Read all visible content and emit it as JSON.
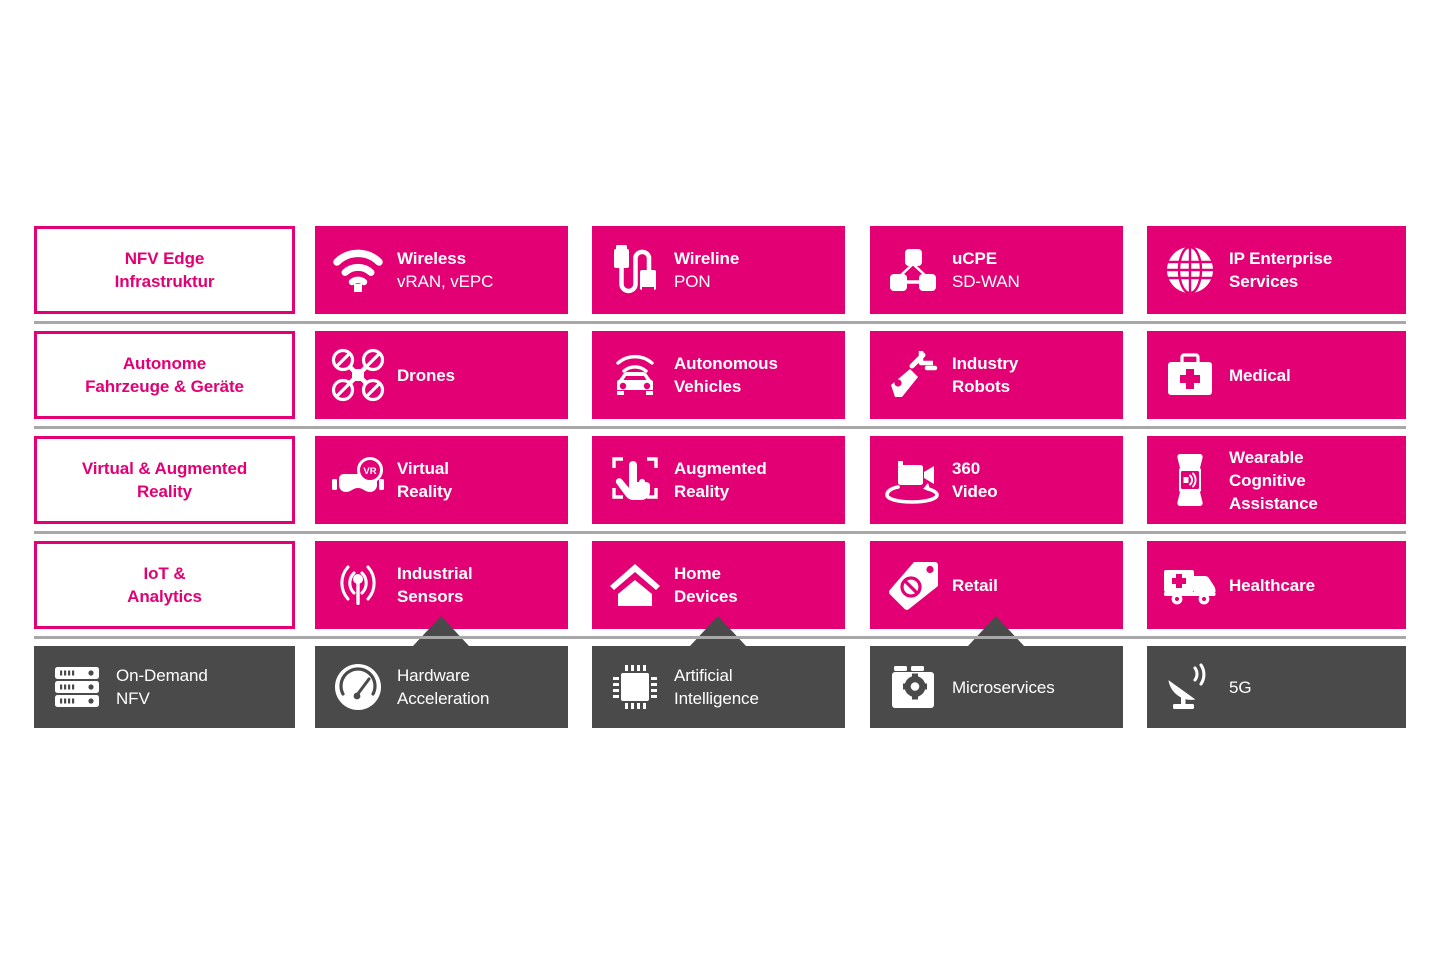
{
  "colors": {
    "magenta": "#e20074",
    "dark_gray": "#4a4a4a",
    "rule_gray": "#a8a8a8",
    "white": "#ffffff"
  },
  "rows": [
    {
      "category": "NFV Edge\nInfrastruktur",
      "cards": [
        {
          "icon": "wifi-icon",
          "line1": "Wireless",
          "line2": "vRAN, vEPC",
          "line2_bold": false
        },
        {
          "icon": "cable-icon",
          "line1": "Wireline",
          "line2": "PON",
          "line2_bold": false
        },
        {
          "icon": "network-node-icon",
          "line1": "uCPE",
          "line2": "SD-WAN",
          "line2_bold": false
        },
        {
          "icon": "globe-icon",
          "line1": "IP Enterprise",
          "line2": "Services",
          "line2_bold": true
        }
      ]
    },
    {
      "category": "Autonome\nFahrzeuge & Geräte",
      "cards": [
        {
          "icon": "drone-icon",
          "line1": "Drones",
          "line2": "",
          "line2_bold": false
        },
        {
          "icon": "autonomous-car-icon",
          "line1": "Autonomous",
          "line2": "Vehicles",
          "line2_bold": true
        },
        {
          "icon": "robot-arm-icon",
          "line1": "Industry",
          "line2": "Robots",
          "line2_bold": true
        },
        {
          "icon": "first-aid-kit-icon",
          "line1": "Medical",
          "line2": "",
          "line2_bold": false
        }
      ]
    },
    {
      "category": "Virtual & Augmented\nReality",
      "cards": [
        {
          "icon": "vr-headset-icon",
          "line1": "Virtual",
          "line2": "Reality",
          "line2_bold": true
        },
        {
          "icon": "ar-hand-icon",
          "line1": "Augmented",
          "line2": "Reality",
          "line2_bold": true
        },
        {
          "icon": "video-360-icon",
          "line1": "360",
          "line2": "Video",
          "line2_bold": true
        },
        {
          "icon": "smartwatch-icon",
          "line1": "Wearable",
          "line2": "Cognitive",
          "line2_bold": true,
          "line3": "Assistance"
        }
      ]
    },
    {
      "category": "IoT &\nAnalytics",
      "cards": [
        {
          "icon": "sensor-antenna-icon",
          "line1": "Industrial",
          "line2": "Sensors",
          "line2_bold": true
        },
        {
          "icon": "house-icon",
          "line1": "Home",
          "line2": "Devices",
          "line2_bold": true
        },
        {
          "icon": "price-tag-icon",
          "line1": "Retail",
          "line2": "",
          "line2_bold": false
        },
        {
          "icon": "ambulance-icon",
          "line1": "Healthcare",
          "line2": "",
          "line2_bold": false
        }
      ]
    }
  ],
  "foundation": {
    "cards": [
      {
        "icon": "server-rack-icon",
        "line1": "On-Demand",
        "line2": "NFV"
      },
      {
        "icon": "gauge-icon",
        "line1": "Hardware",
        "line2": "Acceleration"
      },
      {
        "icon": "cpu-chip-icon",
        "line1": "Artificial",
        "line2": "Intelligence"
      },
      {
        "icon": "container-gear-icon",
        "line1": "Microservices",
        "line2": ""
      },
      {
        "icon": "satellite-dish-icon",
        "line1": "5G",
        "line2": ""
      }
    ]
  }
}
